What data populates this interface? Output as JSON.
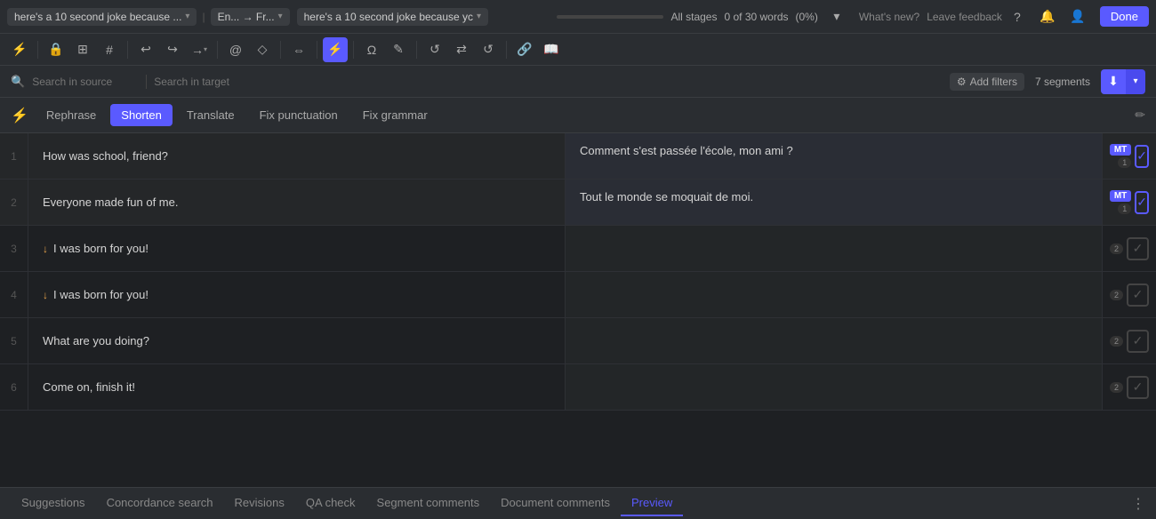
{
  "topNav": {
    "sourceDoc": "here's a 10 second joke because ...",
    "langPair": "En... → Fr...",
    "targetDoc": "here's a 10 second joke because yc",
    "allStages": "All stages",
    "wordCount": "0 of 30 words",
    "wordPercent": "(0%)",
    "whatsNew": "What's new?",
    "leaveFeedback": "Leave feedback",
    "done": "Done",
    "icons": {
      "help": "?",
      "bell": "🔔",
      "profile": "👤"
    }
  },
  "toolbar": {
    "buttons": [
      {
        "name": "lightning",
        "icon": "⚡",
        "active": false
      },
      {
        "name": "lock",
        "icon": "🔒",
        "active": false
      },
      {
        "name": "split",
        "icon": "⊞",
        "active": false
      },
      {
        "name": "hash",
        "icon": "#",
        "active": false
      },
      {
        "name": "undo",
        "icon": "↩",
        "active": false
      },
      {
        "name": "redo",
        "icon": "↪",
        "active": false
      },
      {
        "name": "forward",
        "icon": "→",
        "active": false
      },
      {
        "name": "at",
        "icon": "@",
        "active": false
      },
      {
        "name": "tag",
        "icon": "◇",
        "active": false
      },
      {
        "name": "merge",
        "icon": "⇔",
        "active": false
      },
      {
        "name": "zap",
        "icon": "⚡",
        "active": true
      },
      {
        "name": "omega",
        "icon": "Ω",
        "active": false
      },
      {
        "name": "edit2",
        "icon": "✎",
        "active": false
      },
      {
        "name": "reset",
        "icon": "↺",
        "active": false
      },
      {
        "name": "arrows",
        "icon": "⇄",
        "active": false
      },
      {
        "name": "undo2",
        "icon": "↺",
        "active": false
      },
      {
        "name": "link",
        "icon": "🔗",
        "active": false
      },
      {
        "name": "book",
        "icon": "📖",
        "active": false
      }
    ]
  },
  "searchBar": {
    "sourceHint": "Search in source",
    "targetHint": "Search in target",
    "addFilters": "Add filters",
    "segmentsCount": "7 segments"
  },
  "aiToolbar": {
    "tabs": [
      {
        "label": "Rephrase",
        "active": false
      },
      {
        "label": "Shorten",
        "active": true
      },
      {
        "label": "Translate",
        "active": false
      },
      {
        "label": "Fix punctuation",
        "active": false
      },
      {
        "label": "Fix grammar",
        "active": false
      }
    ]
  },
  "segments": [
    {
      "num": "1",
      "source": "How was school, friend?",
      "target": "Comment s'est passée l'école, mon ami ?",
      "mt": true,
      "confirmed": true,
      "badge": "1",
      "warning": false
    },
    {
      "num": "2",
      "source": "Everyone made fun of me.",
      "target": "Tout le monde se moquait de moi.",
      "mt": true,
      "confirmed": true,
      "badge": "1",
      "warning": false
    },
    {
      "num": "3",
      "source": "I was born for you!",
      "target": "",
      "mt": false,
      "confirmed": false,
      "badge": "2",
      "warning": true
    },
    {
      "num": "4",
      "source": "I was born for you!",
      "target": "",
      "mt": false,
      "confirmed": false,
      "badge": "2",
      "warning": true
    },
    {
      "num": "5",
      "source": "What are you doing?",
      "target": "",
      "mt": false,
      "confirmed": false,
      "badge": "2",
      "warning": false
    },
    {
      "num": "6",
      "source": "Come on, finish it!",
      "target": "",
      "mt": false,
      "confirmed": false,
      "badge": "2",
      "warning": false
    }
  ],
  "bottomTabs": [
    {
      "label": "Suggestions",
      "active": false
    },
    {
      "label": "Concordance search",
      "active": false
    },
    {
      "label": "Revisions",
      "active": false
    },
    {
      "label": "QA check",
      "active": false
    },
    {
      "label": "Segment comments",
      "active": false
    },
    {
      "label": "Document comments",
      "active": false
    },
    {
      "label": "Preview",
      "active": true
    }
  ]
}
